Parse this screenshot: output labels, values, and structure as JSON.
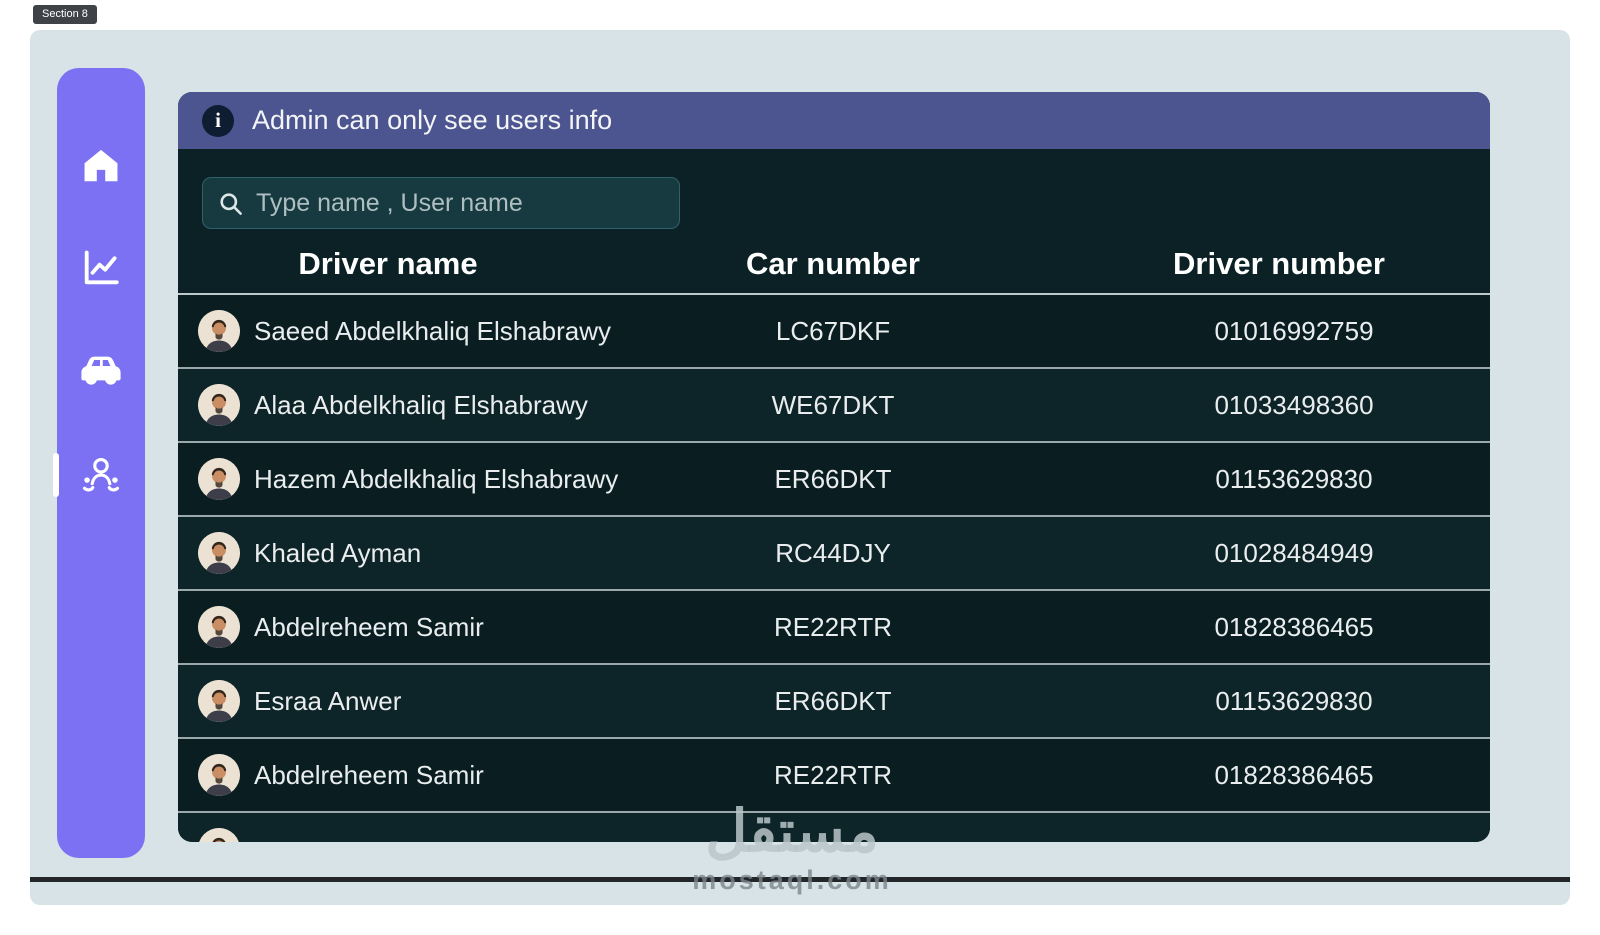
{
  "section_badge": "Section 8",
  "sidebar": {
    "background": "#7b71f2",
    "items": [
      {
        "id": "home",
        "icon": "home-icon",
        "active": false
      },
      {
        "id": "analytics",
        "icon": "line-chart-icon",
        "active": false
      },
      {
        "id": "cars",
        "icon": "car-icon",
        "active": false
      },
      {
        "id": "users",
        "icon": "users-icon",
        "active": true
      }
    ]
  },
  "banner": {
    "icon": "info-icon",
    "text": "Admin can only see users info",
    "background": "#4c5590"
  },
  "search": {
    "icon": "search-icon",
    "placeholder": "Type name , User name"
  },
  "table": {
    "columns": [
      "Driver name",
      "Car number",
      "Driver number"
    ],
    "rows": [
      {
        "name": "Saeed Abdelkhaliq Elshabrawy",
        "car": "LC67DKF",
        "phone": "01016992759"
      },
      {
        "name": "Alaa Abdelkhaliq Elshabrawy",
        "car": "WE67DKT",
        "phone": "01033498360"
      },
      {
        "name": "Hazem Abdelkhaliq Elshabrawy",
        "car": "ER66DKT",
        "phone": "01153629830"
      },
      {
        "name": "Khaled Ayman",
        "car": "RC44DJY",
        "phone": "01028484949"
      },
      {
        "name": "Abdelreheem Samir",
        "car": "RE22RTR",
        "phone": "01828386465"
      },
      {
        "name": "Esraa Anwer",
        "car": "ER66DKT",
        "phone": "01153629830"
      },
      {
        "name": "Abdelreheem Samir",
        "car": "RE22RTR",
        "phone": "01828386465"
      },
      {
        "name": "",
        "car": "",
        "phone": ""
      }
    ]
  },
  "watermark": {
    "arabic": "مستقل",
    "latin": "mostaql.com"
  },
  "colors": {
    "page_background": "#d7e3e7",
    "panel_background": "#0b2125",
    "banner_background": "#4c5590",
    "sidebar_background": "#7b71f2",
    "search_background": "#173a40"
  }
}
